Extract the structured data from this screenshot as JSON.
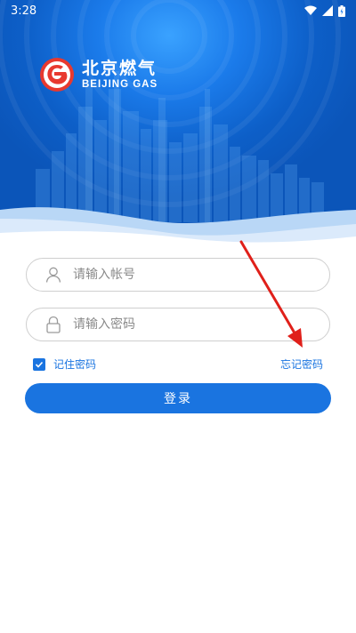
{
  "status_bar": {
    "time": "3:28"
  },
  "logo": {
    "cn": "北京燃气",
    "en": "BEIJING GAS"
  },
  "form": {
    "account_placeholder": "请输入帐号",
    "password_placeholder": "请输入密码",
    "remember_label": "记住密码",
    "remember_checked": true,
    "forgot_label": "忘记密码",
    "login_label": "登录"
  },
  "icons": {
    "wifi": "wifi-icon",
    "signal": "signal-icon",
    "battery": "battery-icon",
    "user": "user-icon",
    "lock": "lock-icon",
    "check": "check-icon",
    "arrow": "red-arrow-annotation"
  },
  "colors": {
    "primary": "#1a74e0",
    "header_dark": "#0b55b9",
    "header_light": "#3aa2ff",
    "logo_red": "#e8392f",
    "arrow_red": "#e0201a"
  }
}
